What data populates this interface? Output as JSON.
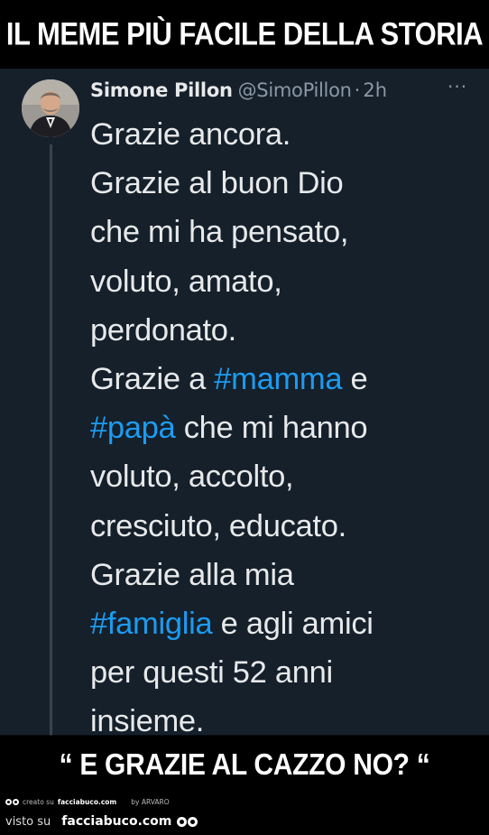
{
  "top_caption": "IL MEME PIÙ FACILE DELLA STORIA",
  "tweet": {
    "author_name": "Simone Pillon",
    "handle": "@SimoPillon",
    "separator": "·",
    "time": "2h",
    "more_icon": "···",
    "lines": [
      {
        "segments": [
          {
            "text": "Grazie ancora."
          }
        ]
      },
      {
        "segments": [
          {
            "text": "Grazie al buon Dio"
          }
        ]
      },
      {
        "segments": [
          {
            "text": "che mi ha pensato,"
          }
        ]
      },
      {
        "segments": [
          {
            "text": "voluto, amato,"
          }
        ]
      },
      {
        "segments": [
          {
            "text": "perdonato."
          }
        ]
      },
      {
        "segments": [
          {
            "text": "Grazie a "
          },
          {
            "text": "#mamma"
          },
          {
            "text": " e"
          }
        ]
      },
      {
        "segments": [
          {
            "text": "#papà"
          },
          {
            "text": " che mi hanno"
          }
        ]
      },
      {
        "segments": [
          {
            "text": "voluto, accolto,"
          }
        ]
      },
      {
        "segments": [
          {
            "text": "cresciuto, educato."
          }
        ]
      },
      {
        "segments": [
          {
            "text": "Grazie alla mia"
          }
        ]
      },
      {
        "segments": [
          {
            "text": "#famiglia"
          },
          {
            "text": " e agli amici"
          }
        ]
      },
      {
        "segments": [
          {
            "text": "per questi 52 anni"
          }
        ]
      },
      {
        "segments": [
          {
            "text": "insieme."
          }
        ]
      }
    ]
  },
  "bottom_caption": "“ E GRAZIE AL CAZZO NO? “",
  "footer": {
    "created_on": "creato su",
    "site_small": "facciabuco.com",
    "by": "by ARVARO",
    "seen_on": "visto su",
    "site": "facciabuco.com"
  },
  "colors": {
    "background": "#000000",
    "tweet_bg": "#15202b",
    "text": "#e7e9ea",
    "muted": "#8b98a5",
    "hashtag": "#1d9bf0"
  }
}
